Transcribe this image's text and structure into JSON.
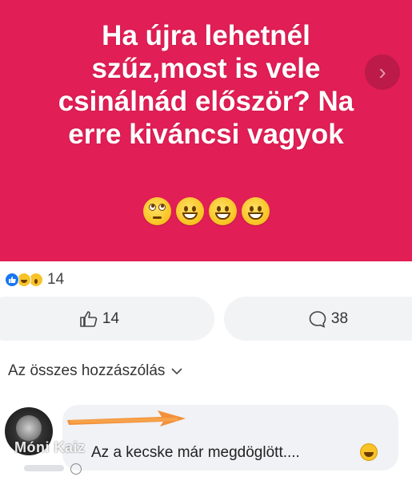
{
  "post": {
    "lines": [
      "Ha újra lehetnél",
      "szűz,most is vele",
      "csinálnád először? Na",
      "erre kiváncsi vagyok"
    ],
    "emojis": [
      "face-with-rolling-eyes",
      "grinning-face",
      "grinning-face",
      "grinning-face"
    ],
    "background_color": "#e11e55"
  },
  "reactions": {
    "icons": [
      "like-icon",
      "haha-icon",
      "wow-icon"
    ],
    "count": "14"
  },
  "actions": {
    "like_count": "14",
    "comment_count": "38"
  },
  "comments": {
    "sort_label": "Az összes hozzászólás",
    "items": [
      {
        "text": "Az a kecske már megdöglött....",
        "emoji": "rolling-on-floor-laughing"
      }
    ]
  },
  "watermark": "Móni Kaiz"
}
